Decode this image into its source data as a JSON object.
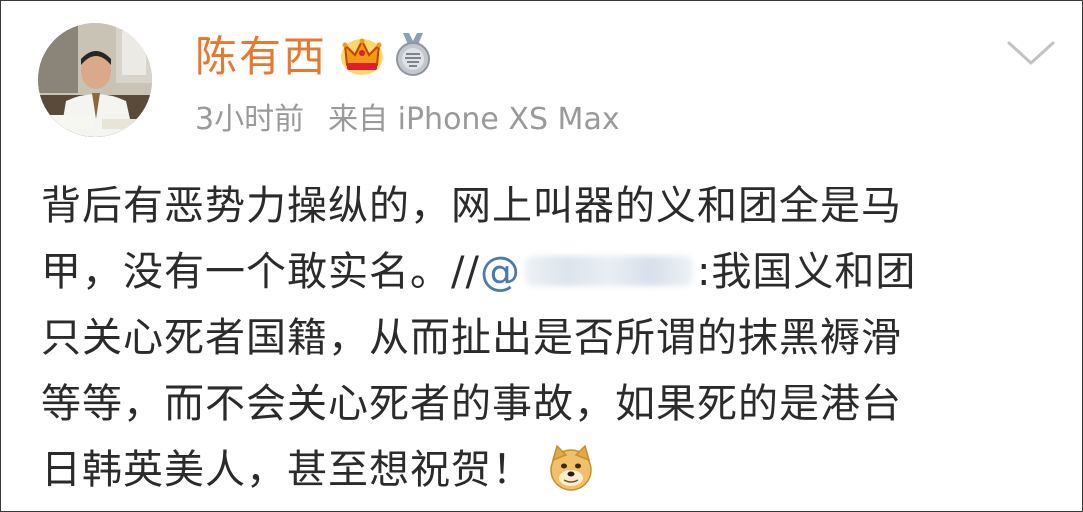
{
  "post": {
    "author": {
      "name": "陈有西"
    },
    "badges": [
      {
        "icon": "crown-badge-icon",
        "color": "#f2a51d"
      },
      {
        "icon": "medal-badge-icon",
        "color": "#b0b6be"
      }
    ],
    "meta": {
      "time": "3小时前",
      "source": "来自 iPhone XS Max"
    },
    "text": {
      "line1": "背后有恶势力操纵的，网上叫器的义和团全是马",
      "line2_before": "甲，没有一个敢实名。//",
      "mention": "@",
      "line2_after": ":我国义和团",
      "line3": "只关心死者国籍，从而扯出是否所谓的抹黑褥滑",
      "line4": "等等，而不会关心死者的事故，如果死的是港台",
      "line5": "日韩英美人，甚至想祝贺！"
    },
    "emoji": {
      "icon": "doge-emoji-icon"
    },
    "menu": {
      "icon": "chevron-down-icon"
    }
  },
  "colors": {
    "username": "#e8772f",
    "meta": "#9a9a9a",
    "text": "#2b2b2b",
    "mention": "#4c7ab0"
  }
}
